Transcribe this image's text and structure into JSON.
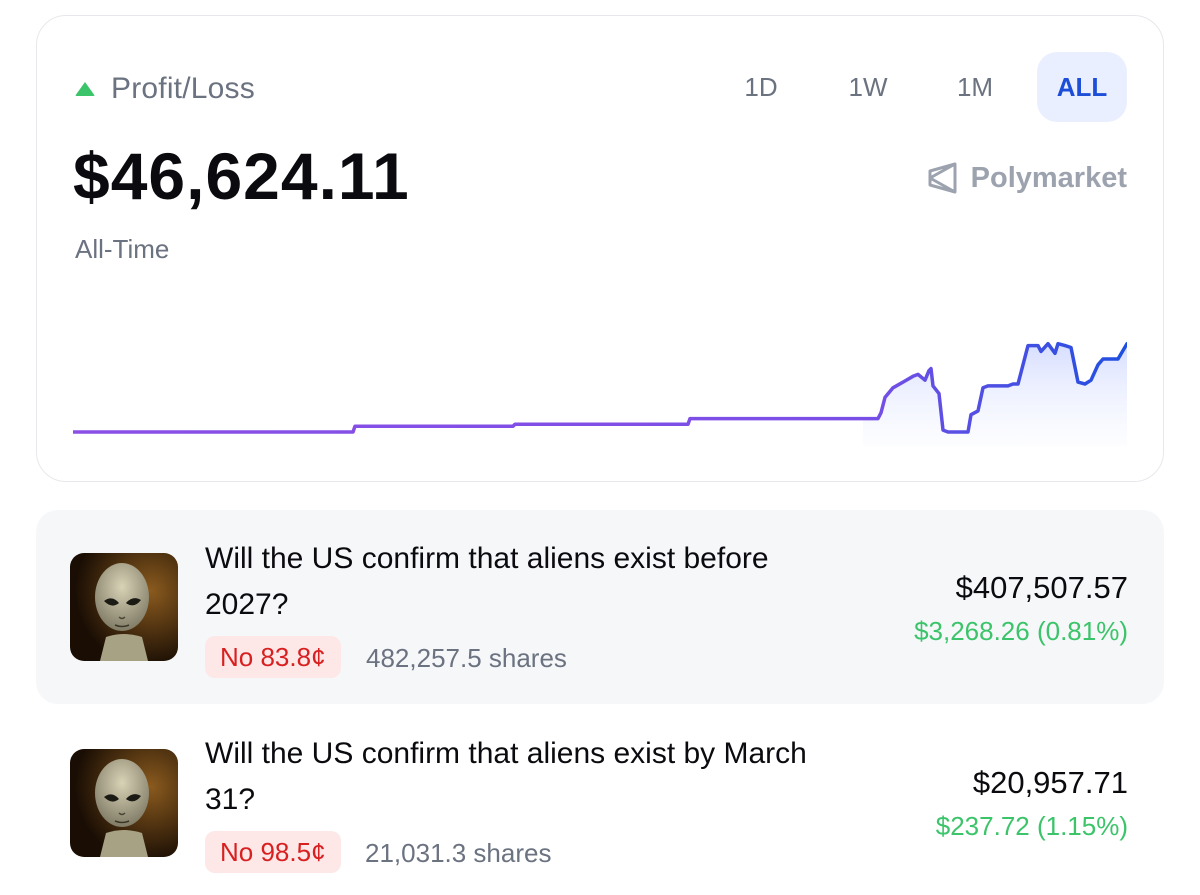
{
  "pnl": {
    "title": "Profit/Loss",
    "value": "$46,624.11",
    "period_label": "All-Time",
    "trend_icon": "triangle-up-icon",
    "ranges": [
      "1D",
      "1W",
      "1M",
      "ALL"
    ],
    "selected_range": "ALL",
    "brand": "Polymarket"
  },
  "colors": {
    "accent": "#1d4ed8",
    "positive": "#3cc46a",
    "negative": "#d92020",
    "line_start": "#8b4fe6",
    "line_end": "#1f4fe0"
  },
  "chart_data": {
    "type": "line",
    "title": "",
    "xlabel": "",
    "ylabel": "",
    "grid": false,
    "x": [
      0,
      40,
      280,
      282,
      440,
      442,
      615,
      617,
      670,
      700,
      805,
      808,
      812,
      820,
      830,
      840,
      845,
      852,
      856,
      858,
      860,
      866,
      870,
      875,
      880,
      895,
      898,
      905,
      910,
      915,
      935,
      940,
      945,
      955,
      965,
      968,
      975,
      982,
      985,
      992,
      998,
      1005,
      1012,
      1018,
      1025,
      1030,
      1045,
      1054
    ],
    "y": [
      0,
      0,
      0,
      6,
      6,
      8,
      8,
      14,
      14,
      14,
      14,
      20,
      36,
      46,
      52,
      58,
      60,
      54,
      64,
      66,
      48,
      40,
      2,
      0,
      0,
      0,
      18,
      22,
      46,
      48,
      48,
      50,
      50,
      90,
      90,
      84,
      92,
      82,
      92,
      90,
      88,
      52,
      50,
      54,
      70,
      76,
      76,
      92
    ],
    "ylim": [
      0,
      100
    ]
  },
  "positions": [
    {
      "title_line1": "Will the US confirm that aliens exist before",
      "title_line2": "2027?",
      "outcome": "No 83.8¢",
      "shares": "482,257.5 shares",
      "value": "$407,507.57",
      "change": "$3,268.26 (0.81%)"
    },
    {
      "title_line1": "Will the US confirm that aliens exist by March",
      "title_line2": "31?",
      "outcome": "No 98.5¢",
      "shares": "21,031.3 shares",
      "value": "$20,957.71",
      "change": "$237.72 (1.15%)"
    }
  ]
}
